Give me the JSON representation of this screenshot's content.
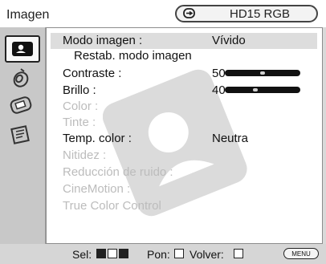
{
  "header": {
    "title": "Imagen",
    "source_icon": "input-source-icon",
    "source_label": "HD15 RGB"
  },
  "sidebar": {
    "tabs": [
      {
        "name": "picture-icon",
        "active": true
      },
      {
        "name": "sound-icon",
        "active": false
      },
      {
        "name": "screen-icon",
        "active": false
      },
      {
        "name": "setup-icon",
        "active": false
      }
    ]
  },
  "menu": {
    "items": [
      {
        "label": "Modo imagen :",
        "value": "Vívido",
        "type": "value",
        "selected": true,
        "dim": false
      },
      {
        "label": "Restab. modo imagen",
        "value": "",
        "type": "action",
        "selected": false,
        "dim": false
      },
      {
        "label": "Contraste :",
        "value": "50",
        "type": "slider",
        "level": 0.5,
        "selected": false,
        "dim": false
      },
      {
        "label": "Brillo :",
        "value": "40",
        "type": "slider",
        "level": 0.4,
        "selected": false,
        "dim": false
      },
      {
        "label": "Color :",
        "value": "",
        "type": "disabled",
        "selected": false,
        "dim": true
      },
      {
        "label": "Tinte :",
        "value": "",
        "type": "disabled",
        "selected": false,
        "dim": true
      },
      {
        "label": "Temp. color :",
        "value": "Neutra",
        "type": "value",
        "selected": false,
        "dim": false
      },
      {
        "label": "Nitidez :",
        "value": "",
        "type": "disabled",
        "selected": false,
        "dim": true
      },
      {
        "label": "Reducción de ruido :",
        "value": "",
        "type": "disabled",
        "selected": false,
        "dim": true
      },
      {
        "label": "CineMotion :",
        "value": "",
        "type": "disabled",
        "selected": false,
        "dim": true
      },
      {
        "label": "True Color Control",
        "value": "",
        "type": "disabled",
        "selected": false,
        "dim": true
      }
    ]
  },
  "footer": {
    "sel_label": "Sel:",
    "pon_label": "Pon:",
    "volver_label": "Volver:",
    "menu_label": "MENU"
  },
  "colors": {
    "accent": "#dddddd",
    "disabled_text": "#bcbcbc",
    "slider": "#111111"
  }
}
